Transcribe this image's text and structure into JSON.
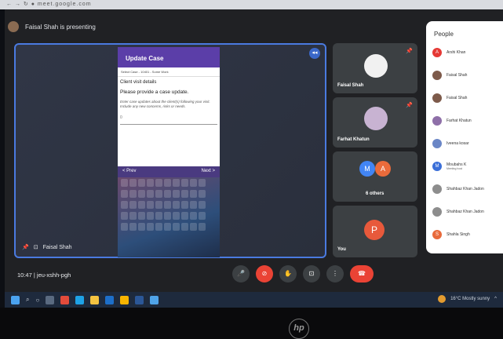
{
  "presenting_text": "Faisal Shah is presenting",
  "stage": {
    "presenter_name": "Faisal Shah"
  },
  "phone": {
    "header_title": "Update Case",
    "sub_text": "Select Case - 10401 - Some Work",
    "section_title": "Client visit details",
    "question": "Please provide a case update.",
    "hint": "Enter case updates about the client(s) following your visit. Include any new concerns, risks or needs.",
    "prev_label": "< Prev",
    "next_label": "Next >"
  },
  "tiles": [
    {
      "name": "Faisal Shah",
      "photo_color": "#f1f1f1"
    },
    {
      "name": "Farhat Khatun",
      "photo_color": "#c8b3d2"
    },
    {
      "name": "6 others",
      "initials": [
        "M",
        "A"
      ],
      "colors": [
        "#4285f4",
        "#ea6b3b"
      ]
    },
    {
      "name": "You",
      "initial": "P",
      "color": "#e8593b"
    }
  ],
  "people": {
    "title": "People",
    "items": [
      {
        "name": "Arshi Khan",
        "initial": "A",
        "color": "#e53935"
      },
      {
        "name": "Faisal Shah",
        "initial": "",
        "color": "#7d5a4a"
      },
      {
        "name": "Faisal Shah",
        "initial": "",
        "color": "#7d5a4a"
      },
      {
        "name": "Farhat Khatun",
        "initial": "",
        "color": "#8e6fa8"
      },
      {
        "name": "Iveena kosar",
        "initial": "",
        "color": "#6a86c6"
      },
      {
        "name": "Moubahs K",
        "subtitle": "Meeting host",
        "initial": "M",
        "color": "#3b6fd8"
      },
      {
        "name": "Shahbaz Khan Jadon",
        "initial": "",
        "color": "#8d8d8d"
      },
      {
        "name": "Shahbaz Khan Jadon",
        "initial": "",
        "color": "#8d8d8d"
      },
      {
        "name": "Shahla Singh",
        "initial": "S",
        "color": "#e86a3b"
      }
    ]
  },
  "meeting": {
    "time": "10:47",
    "code": "jeu-xshh-pgh"
  },
  "taskbar": {
    "weather": "16°C Mostly sunny"
  },
  "brand": "hp"
}
